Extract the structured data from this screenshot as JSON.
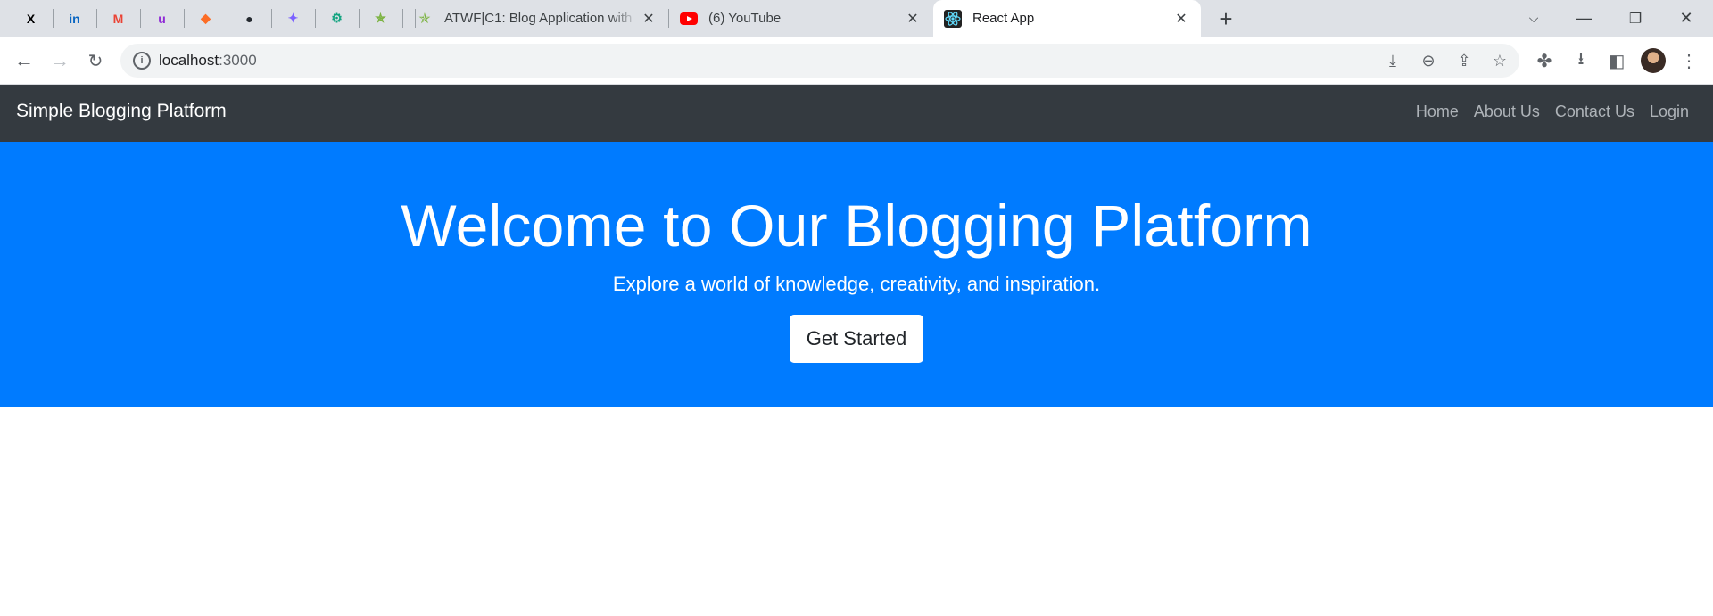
{
  "browser": {
    "pinned_tabs": [
      {
        "icon": "x-twitter-icon",
        "glyph": "X",
        "color": "#000000"
      },
      {
        "icon": "linkedin-icon",
        "glyph": "in",
        "color": "#0a66c2"
      },
      {
        "icon": "gmail-icon",
        "glyph": "M",
        "color": "#ea4335"
      },
      {
        "icon": "unstop-icon",
        "glyph": "u",
        "color": "#8f2ad6"
      },
      {
        "icon": "gitlab-icon",
        "glyph": "◆",
        "color": "#fc6d26"
      },
      {
        "icon": "github-icon",
        "glyph": "●",
        "color": "#24292f"
      },
      {
        "icon": "gemini-icon",
        "glyph": "✦",
        "color": "#7b61ff"
      },
      {
        "icon": "chatgpt-icon",
        "glyph": "⚙",
        "color": "#10a37f"
      },
      {
        "icon": "runner-icon",
        "glyph": "✯",
        "color": "#7cb342"
      }
    ],
    "tabs": [
      {
        "title": "ATWF|C1: Blog Application with",
        "icon": "runner-icon"
      },
      {
        "title": "(6) YouTube",
        "icon": "youtube-icon"
      },
      {
        "title": "React App",
        "icon": "react-icon",
        "active": true
      }
    ],
    "address": {
      "host": "localhost",
      "port": ":3000"
    }
  },
  "site": {
    "brand": "Simple Blogging Platform",
    "nav_links": [
      "Home",
      "About Us",
      "Contact Us",
      "Login"
    ],
    "hero": {
      "title": "Welcome to Our Blogging Platform",
      "subtitle": "Explore a world of knowledge, creativity, and inspiration.",
      "cta": "Get Started"
    }
  },
  "colors": {
    "navbar": "#343a40",
    "hero": "#007bff",
    "tabstrip": "#dee1e6"
  }
}
